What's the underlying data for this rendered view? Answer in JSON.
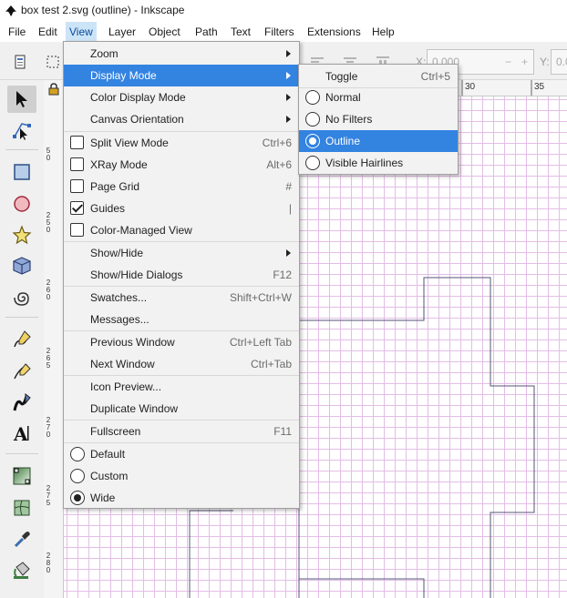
{
  "window": {
    "title": "box test 2.svg (outline) - Inkscape"
  },
  "menubar": {
    "items": [
      {
        "label": "File"
      },
      {
        "label": "Edit"
      },
      {
        "label": "View"
      },
      {
        "label": "Layer"
      },
      {
        "label": "Object"
      },
      {
        "label": "Path"
      },
      {
        "label": "Text"
      },
      {
        "label": "Filters"
      },
      {
        "label": "Extensions"
      },
      {
        "label": "Help"
      }
    ],
    "active": "View"
  },
  "toolbar": {
    "x_label": "X:",
    "x_value": "0.000",
    "y_label": "Y:",
    "y_value": "0.0"
  },
  "ruler": {
    "h_labels": [
      "30",
      "35"
    ],
    "v_labels": [
      "5",
      "0",
      "2",
      "5",
      "0",
      "2",
      "6",
      "0",
      "2",
      "6",
      "5",
      "2",
      "7",
      "0",
      "2",
      "7",
      "5",
      "2",
      "8",
      "0",
      "2",
      "8",
      "5"
    ]
  },
  "view_menu": {
    "items": [
      {
        "label": "Zoom",
        "submenu": true
      },
      {
        "label": "Display Mode",
        "submenu": true,
        "highlighted": true
      },
      {
        "label": "Color Display Mode",
        "submenu": true
      },
      {
        "label": "Canvas Orientation",
        "submenu": true
      },
      {
        "label": "Split View Mode",
        "shortcut": "Ctrl+6",
        "checkbox": false
      },
      {
        "label": "XRay Mode",
        "shortcut": "Alt+6",
        "checkbox": false
      },
      {
        "label": "Page Grid",
        "shortcut": "#",
        "checkbox": false
      },
      {
        "label": "Guides",
        "shortcut": "|",
        "checkbox": true
      },
      {
        "label": "Color-Managed View",
        "checkbox": false
      },
      {
        "label": "Show/Hide",
        "submenu": true
      },
      {
        "label": "Show/Hide Dialogs",
        "shortcut": "F12"
      },
      {
        "label": "Swatches...",
        "shortcut": "Shift+Ctrl+W"
      },
      {
        "label": "Messages..."
      },
      {
        "label": "Previous Window",
        "shortcut": "Ctrl+Left Tab"
      },
      {
        "label": "Next Window",
        "shortcut": "Ctrl+Tab"
      },
      {
        "label": "Icon Preview..."
      },
      {
        "label": "Duplicate Window"
      },
      {
        "label": "Fullscreen",
        "shortcut": "F11"
      },
      {
        "label": "Default",
        "radio": false
      },
      {
        "label": "Custom",
        "radio": false
      },
      {
        "label": "Wide",
        "radio": true
      }
    ]
  },
  "display_mode_submenu": {
    "items": [
      {
        "label": "Toggle",
        "shortcut": "Ctrl+5"
      },
      {
        "label": "Normal",
        "radio": false
      },
      {
        "label": "No Filters",
        "radio": false
      },
      {
        "label": "Outline",
        "radio": true,
        "highlighted": true
      },
      {
        "label": "Visible Hairlines",
        "radio": false
      }
    ]
  },
  "colors": {
    "accent": "#3383e1",
    "grid": "#e3bde6",
    "outline": "#555577"
  },
  "tool_icons": [
    "selector-icon",
    "node-icon",
    "rectangle-icon",
    "ellipse-icon",
    "star-icon",
    "box3d-icon",
    "spiral-icon",
    "pencil-icon",
    "pen-icon",
    "calligraphy-icon",
    "text-icon",
    "gradient-icon",
    "mesh-icon",
    "dropper-icon",
    "paint-bucket-icon"
  ]
}
